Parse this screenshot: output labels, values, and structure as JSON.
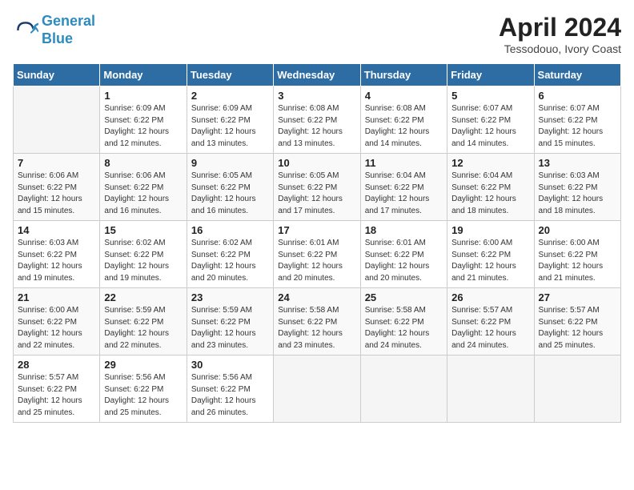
{
  "header": {
    "logo_line1": "General",
    "logo_line2": "Blue",
    "month": "April 2024",
    "location": "Tessodouo, Ivory Coast"
  },
  "weekdays": [
    "Sunday",
    "Monday",
    "Tuesday",
    "Wednesday",
    "Thursday",
    "Friday",
    "Saturday"
  ],
  "weeks": [
    [
      {
        "day": null
      },
      {
        "day": 1,
        "sunrise": "6:09 AM",
        "sunset": "6:22 PM",
        "daylight": "12 hours and 12 minutes."
      },
      {
        "day": 2,
        "sunrise": "6:09 AM",
        "sunset": "6:22 PM",
        "daylight": "12 hours and 13 minutes."
      },
      {
        "day": 3,
        "sunrise": "6:08 AM",
        "sunset": "6:22 PM",
        "daylight": "12 hours and 13 minutes."
      },
      {
        "day": 4,
        "sunrise": "6:08 AM",
        "sunset": "6:22 PM",
        "daylight": "12 hours and 14 minutes."
      },
      {
        "day": 5,
        "sunrise": "6:07 AM",
        "sunset": "6:22 PM",
        "daylight": "12 hours and 14 minutes."
      },
      {
        "day": 6,
        "sunrise": "6:07 AM",
        "sunset": "6:22 PM",
        "daylight": "12 hours and 15 minutes."
      }
    ],
    [
      {
        "day": 7,
        "sunrise": "6:06 AM",
        "sunset": "6:22 PM",
        "daylight": "12 hours and 15 minutes."
      },
      {
        "day": 8,
        "sunrise": "6:06 AM",
        "sunset": "6:22 PM",
        "daylight": "12 hours and 16 minutes."
      },
      {
        "day": 9,
        "sunrise": "6:05 AM",
        "sunset": "6:22 PM",
        "daylight": "12 hours and 16 minutes."
      },
      {
        "day": 10,
        "sunrise": "6:05 AM",
        "sunset": "6:22 PM",
        "daylight": "12 hours and 17 minutes."
      },
      {
        "day": 11,
        "sunrise": "6:04 AM",
        "sunset": "6:22 PM",
        "daylight": "12 hours and 17 minutes."
      },
      {
        "day": 12,
        "sunrise": "6:04 AM",
        "sunset": "6:22 PM",
        "daylight": "12 hours and 18 minutes."
      },
      {
        "day": 13,
        "sunrise": "6:03 AM",
        "sunset": "6:22 PM",
        "daylight": "12 hours and 18 minutes."
      }
    ],
    [
      {
        "day": 14,
        "sunrise": "6:03 AM",
        "sunset": "6:22 PM",
        "daylight": "12 hours and 19 minutes."
      },
      {
        "day": 15,
        "sunrise": "6:02 AM",
        "sunset": "6:22 PM",
        "daylight": "12 hours and 19 minutes."
      },
      {
        "day": 16,
        "sunrise": "6:02 AM",
        "sunset": "6:22 PM",
        "daylight": "12 hours and 20 minutes."
      },
      {
        "day": 17,
        "sunrise": "6:01 AM",
        "sunset": "6:22 PM",
        "daylight": "12 hours and 20 minutes."
      },
      {
        "day": 18,
        "sunrise": "6:01 AM",
        "sunset": "6:22 PM",
        "daylight": "12 hours and 20 minutes."
      },
      {
        "day": 19,
        "sunrise": "6:00 AM",
        "sunset": "6:22 PM",
        "daylight": "12 hours and 21 minutes."
      },
      {
        "day": 20,
        "sunrise": "6:00 AM",
        "sunset": "6:22 PM",
        "daylight": "12 hours and 21 minutes."
      }
    ],
    [
      {
        "day": 21,
        "sunrise": "6:00 AM",
        "sunset": "6:22 PM",
        "daylight": "12 hours and 22 minutes."
      },
      {
        "day": 22,
        "sunrise": "5:59 AM",
        "sunset": "6:22 PM",
        "daylight": "12 hours and 22 minutes."
      },
      {
        "day": 23,
        "sunrise": "5:59 AM",
        "sunset": "6:22 PM",
        "daylight": "12 hours and 23 minutes."
      },
      {
        "day": 24,
        "sunrise": "5:58 AM",
        "sunset": "6:22 PM",
        "daylight": "12 hours and 23 minutes."
      },
      {
        "day": 25,
        "sunrise": "5:58 AM",
        "sunset": "6:22 PM",
        "daylight": "12 hours and 24 minutes."
      },
      {
        "day": 26,
        "sunrise": "5:57 AM",
        "sunset": "6:22 PM",
        "daylight": "12 hours and 24 minutes."
      },
      {
        "day": 27,
        "sunrise": "5:57 AM",
        "sunset": "6:22 PM",
        "daylight": "12 hours and 25 minutes."
      }
    ],
    [
      {
        "day": 28,
        "sunrise": "5:57 AM",
        "sunset": "6:22 PM",
        "daylight": "12 hours and 25 minutes."
      },
      {
        "day": 29,
        "sunrise": "5:56 AM",
        "sunset": "6:22 PM",
        "daylight": "12 hours and 25 minutes."
      },
      {
        "day": 30,
        "sunrise": "5:56 AM",
        "sunset": "6:22 PM",
        "daylight": "12 hours and 26 minutes."
      },
      {
        "day": null
      },
      {
        "day": null
      },
      {
        "day": null
      },
      {
        "day": null
      }
    ]
  ]
}
